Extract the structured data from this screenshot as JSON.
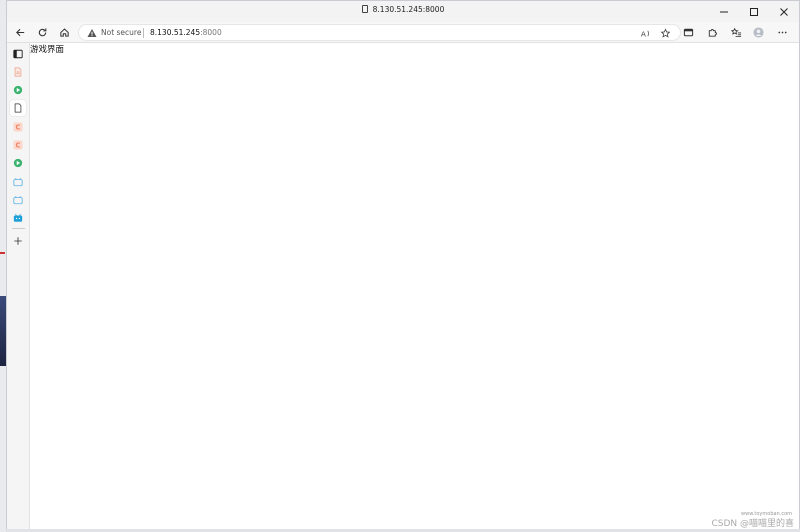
{
  "window": {
    "title": "8.130.51.245:8000"
  },
  "toolbar": {
    "security_label": "Not secure",
    "url_host": "8.130.51.245",
    "url_port": ":8000"
  },
  "sidebar": {
    "items": [
      {
        "icon": "tab-actions-icon"
      },
      {
        "icon": "pdf-doc-icon",
        "color": "#e8a08a"
      },
      {
        "icon": "green-circle-icon",
        "color": "#3cb371"
      },
      {
        "icon": "page-icon",
        "active": true
      },
      {
        "icon": "csdn-c-icon",
        "color": "#f08060"
      },
      {
        "icon": "csdn-c-icon",
        "color": "#f08060"
      },
      {
        "icon": "green-circle-icon",
        "color": "#3cb371"
      },
      {
        "icon": "bilibili-icon",
        "color": "#5ab0e6"
      },
      {
        "icon": "bilibili-icon",
        "color": "#5ab0e6"
      },
      {
        "icon": "bilibili-icon",
        "color": "#20a0d8"
      },
      {
        "icon": "add-icon"
      }
    ]
  },
  "content": {
    "text": "游戏界面"
  },
  "watermark": {
    "small": "www.toymoban.com",
    "main": "CSDN @喵喵里的喜"
  },
  "colors": {
    "titlebar": "#f3f3f3",
    "toolbar": "#f7f7f7",
    "page_bg": "#ffffff"
  }
}
